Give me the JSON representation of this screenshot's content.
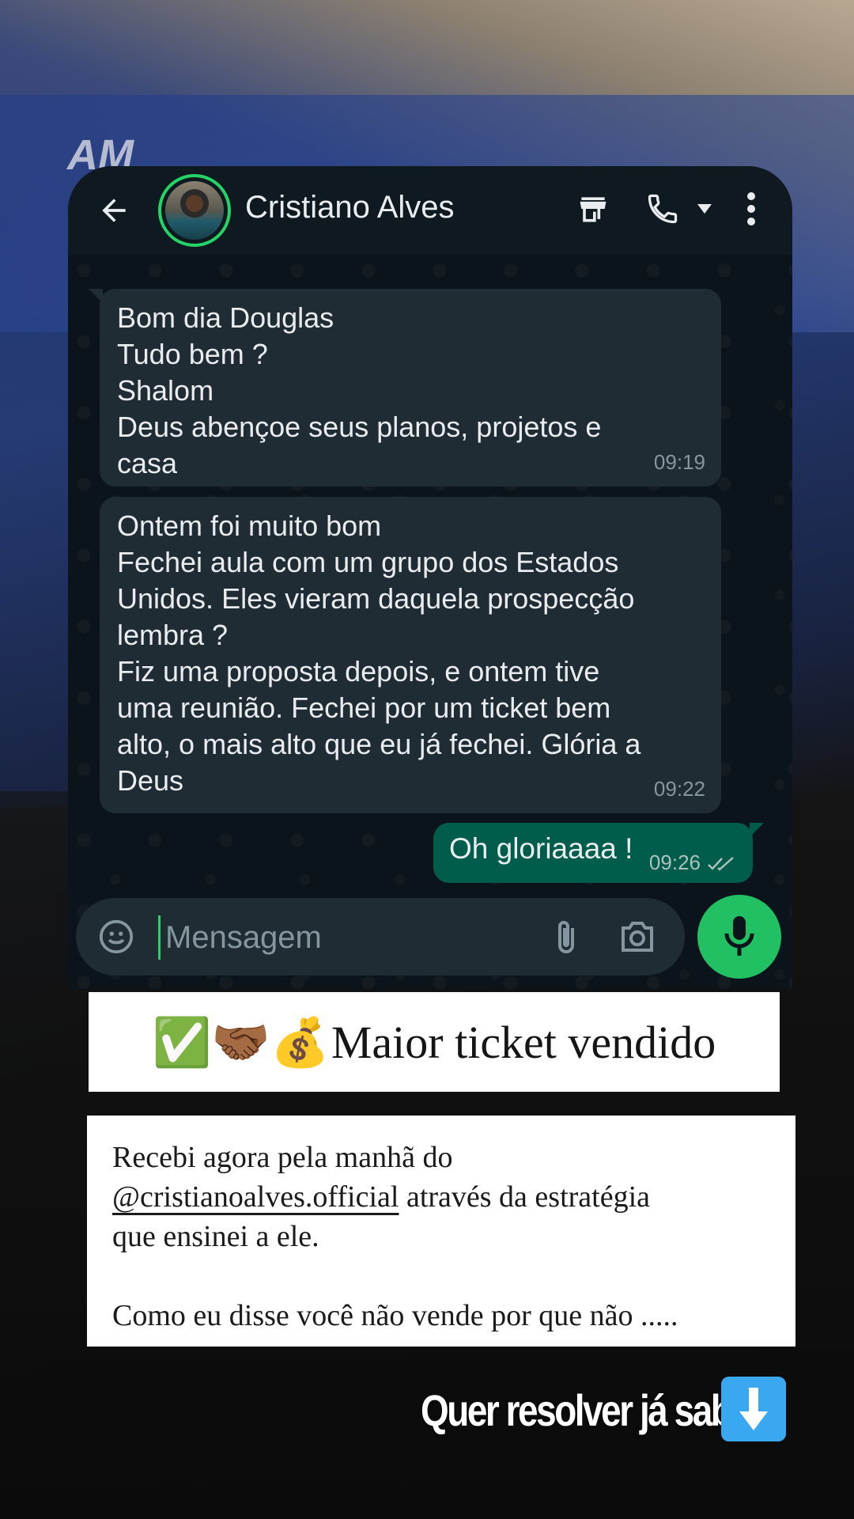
{
  "chat": {
    "contact_name": "Cristiano Alves",
    "message_placeholder": "Mensagem",
    "messages": [
      {
        "direction": "in",
        "text": "Bom dia Douglas\nTudo bem ?\nShalom\nDeus abençoe seus planos, projetos e\ncasa",
        "time": "09:19"
      },
      {
        "direction": "in",
        "text": "Ontem foi muito bom\nFechei aula com um grupo dos Estados\nUnidos. Eles vieram daquela prospecção\nlembra ?\nFiz uma proposta depois, e ontem tive\numa reunião. Fechei por um ticket bem\nalto, o mais alto que eu já fechei. Glória a\nDeus",
        "time": "09:22"
      },
      {
        "direction": "out",
        "text": "Oh gloriaaaa !",
        "time": "09:26",
        "status": "read"
      }
    ]
  },
  "caption": {
    "emojis": "✅🤝🏾💰",
    "title": "Maior ticket vendido",
    "body_line1": "Recebi agora pela manhã do",
    "mention": "@cristianoalves.official",
    "body_line2": " através da estratégia",
    "body_line3": "que ensinei a ele.",
    "body_line4": "Como eu disse você não vende por que não .....",
    "cta": "Quer resolver já sabe"
  },
  "background": {
    "screen_text": "AM"
  },
  "colors": {
    "chat_bg": "#0b141a",
    "incoming_bubble": "#202c33",
    "outgoing_bubble": "#005c4b",
    "accent_green": "#25d366",
    "mic_button": "#21c063"
  }
}
